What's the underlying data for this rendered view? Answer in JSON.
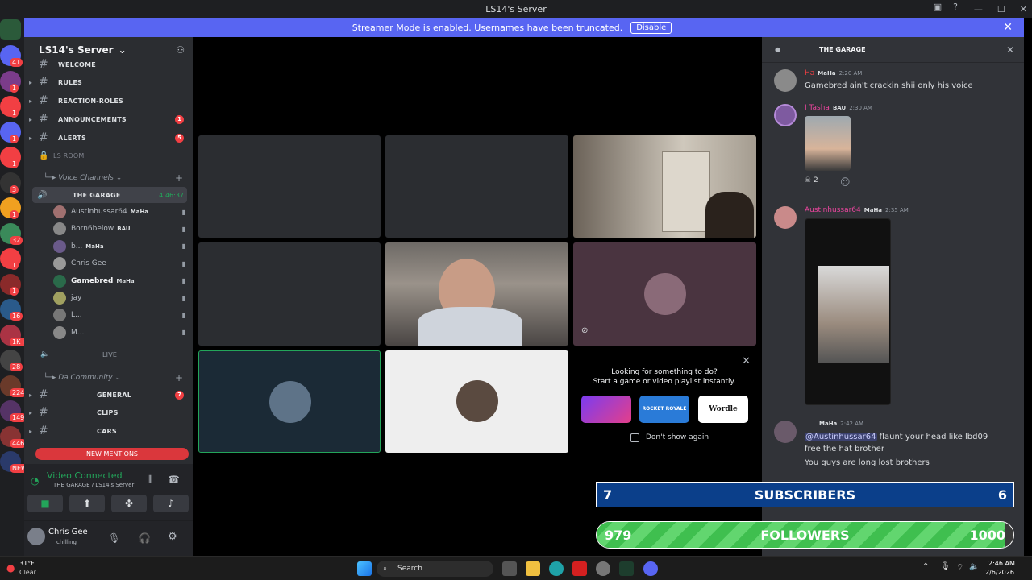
{
  "window": {
    "title": "LS14's Server"
  },
  "banner": {
    "text": "Streamer Mode is enabled. Usernames have been truncated.",
    "button": "Disable"
  },
  "server_rail": {
    "badges": [
      "41",
      "1",
      "1",
      "1",
      "1",
      "3",
      "1",
      "32",
      "1",
      "1",
      "16",
      "1K+",
      "28",
      "224",
      "149",
      "446",
      "NEW"
    ]
  },
  "server": {
    "name": "LS14's Server"
  },
  "channels": [
    {
      "name": "WELCOME",
      "count": ""
    },
    {
      "name": "RULES",
      "count": ""
    },
    {
      "name": "REACTION-ROLES",
      "count": ""
    },
    {
      "name": "ANNOUNCEMENTS",
      "count": "1"
    },
    {
      "name": "ALERTS",
      "count": "5"
    }
  ],
  "ls_room": "LS ROOM",
  "voice_category": "Voice Channels",
  "voice_channel": {
    "name": "THE GARAGE",
    "timer": "4:46:37"
  },
  "voice_users": [
    {
      "name": "Austinhussar64",
      "tag": "MaHa"
    },
    {
      "name": "Born6below",
      "tag": "BAU"
    },
    {
      "name": "b...",
      "tag": "MaHa"
    },
    {
      "name": "Chris Gee",
      "tag": ""
    },
    {
      "name": "Gamebred",
      "tag": "MaHa"
    },
    {
      "name": "jay",
      "tag": ""
    },
    {
      "name": "L...",
      "tag": ""
    },
    {
      "name": "M...",
      "tag": ""
    }
  ],
  "live_channel": "LIVE",
  "community_category": "Da Community",
  "community_channels": [
    {
      "name": "GENERAL",
      "count": "7"
    },
    {
      "name": "CLIPS",
      "count": ""
    },
    {
      "name": "CARS",
      "count": ""
    }
  ],
  "new_mentions": "NEW MENTIONS",
  "voice_status": {
    "title": "Video Connected",
    "sub": "THE GARAGE / LS14's Server"
  },
  "user": {
    "name": "Chris Gee",
    "status": "chilling"
  },
  "activity": {
    "line1": "Looking for something to do?",
    "line2": "Start a game or video playlist instantly.",
    "dont_show": "Don't show again",
    "games": [
      "ROCKET ROYALE",
      "Wordle"
    ]
  },
  "chat": {
    "channel": "THE GARAGE",
    "messages": [
      {
        "name": "Ha",
        "tag": "MaHa",
        "time": "2:20 AM",
        "text": "Gamebred ain't crackin shii only his voice"
      },
      {
        "name": "I Tasha",
        "tag": "BAU",
        "time": "2:30 AM",
        "reaction": "2"
      },
      {
        "name": "Austinhussar64",
        "tag": "MaHa",
        "time": "2:35 AM"
      },
      {
        "name": "",
        "tag": "MaHa",
        "time": "2:42 AM",
        "mention": "@Austinhussar64",
        "text": " flaunt your head like lbd09 free the hat brother",
        "text2": "You guys are long lost brothers"
      }
    ]
  },
  "overlays": {
    "subs": {
      "left": "7",
      "label": "SUBSCRIBERS",
      "right": "6"
    },
    "followers": {
      "left": "979",
      "label": "FOLLOWERS",
      "right": "1000",
      "progress": 0.979
    }
  },
  "taskbar": {
    "weather_temp": "31°F",
    "weather_cond": "Clear",
    "search": "Search",
    "time": "2:46 AM",
    "date": "2/6/2026"
  },
  "colors": {
    "blurple": "#5865f2",
    "green": "#23a55a",
    "red": "#f23f43"
  }
}
